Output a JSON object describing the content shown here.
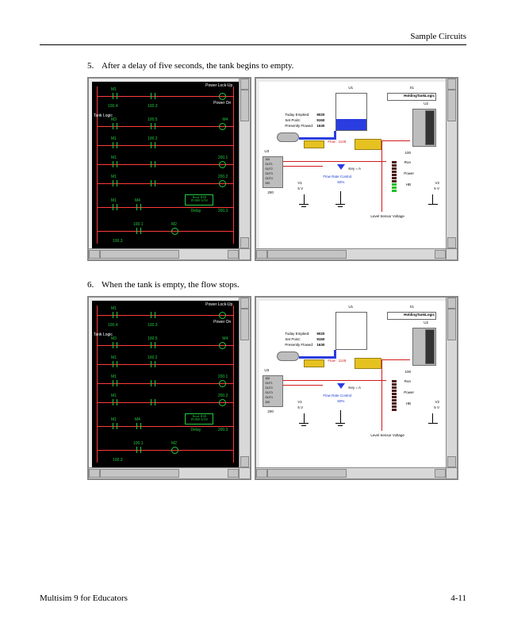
{
  "header": {
    "section_title": "Sample Circuits"
  },
  "steps": [
    {
      "num": "5.",
      "text": "After a delay of five seconds, the tank begins to empty."
    },
    {
      "num": "6.",
      "text": "When the tank is empty, the flow stops."
    }
  ],
  "ladder": {
    "title_top": "Power Lock-Up",
    "title_side": "Tank Logic",
    "power_on": "Power On",
    "refs": {
      "M1": "M1",
      "M2": "M2",
      "M3": "M3",
      "M4": "M4",
      "r1004": "100.4",
      "r1003": "100.3",
      "r1005": "100.5",
      "r1001": "100.1",
      "r1002": "100.2",
      "r2001": "200.1",
      "r2002": "200.2",
      "r2003": "200.3"
    },
    "timer": {
      "top": "Reset   H3B",
      "mid": "PU888 TrTH",
      "label": "Delay"
    }
  },
  "schematic": {
    "block_title": "HoldingTankLogic",
    "U1": "U1",
    "U2": "U2",
    "U3": "U3",
    "X1": "X1",
    "params": {
      "l1": "Today  Emptied:",
      "v1": "9020",
      "l2": "Set  Point:",
      "v2": "9150",
      "l3": "Presently  Flowed:",
      "v3": "1630"
    },
    "flow_rate": "Flow : 1148",
    "pot": {
      "label": "Flow Rate Control",
      "value": "50%",
      "key": "Key = A"
    },
    "plc_labels": [
      "100",
      "OUT1",
      "OUT2",
      "OUT3",
      "OUT4",
      "200"
    ],
    "ref_200": "200",
    "v1": {
      "name": "V1",
      "val": "5 V"
    },
    "v2": {
      "name": "V2",
      "val": "5 V"
    },
    "level_sensor": "Level Sensor Voltage",
    "leds_label_100": "100",
    "leds_label_run": "Run",
    "leds_label_power": "Power",
    "leds_label_hb": "HB"
  },
  "footer": {
    "left": "Multisim 9 for Educators",
    "right": "4-11"
  }
}
